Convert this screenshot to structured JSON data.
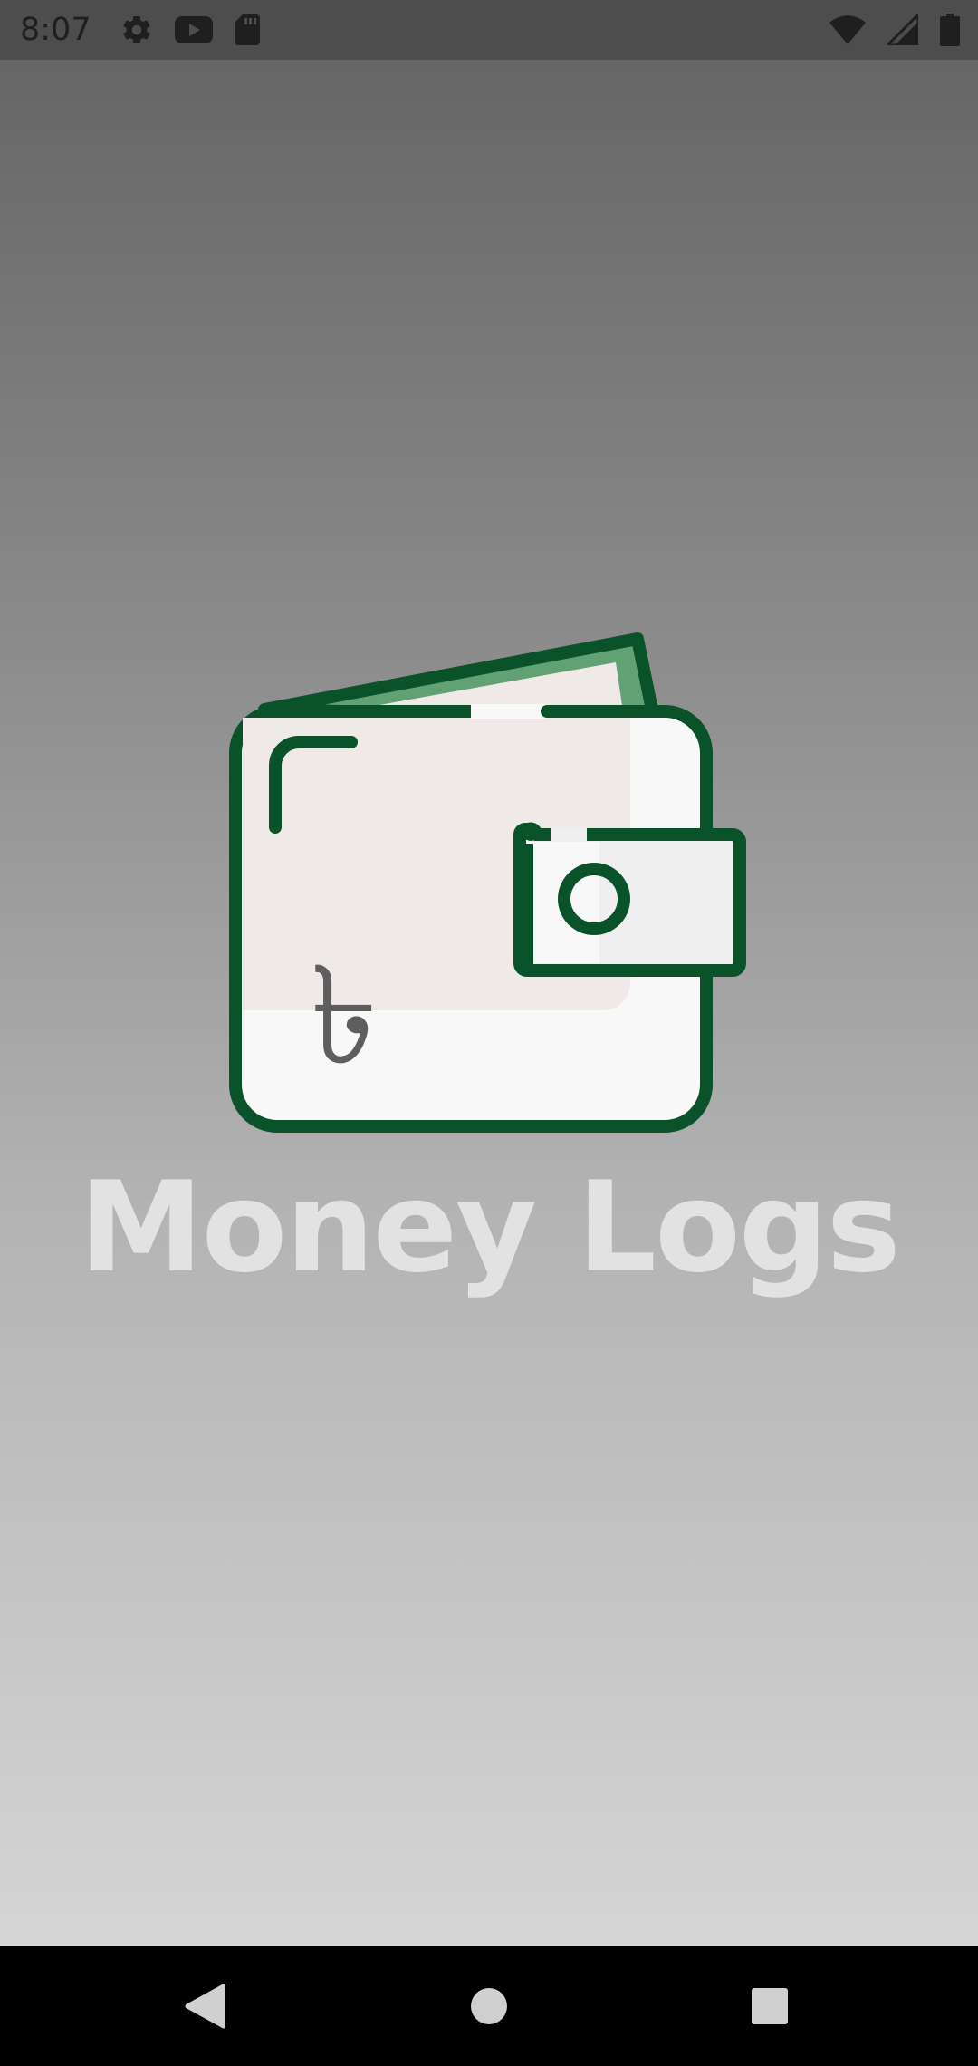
{
  "status_bar": {
    "time": "8:07",
    "left_icons": [
      "settings-icon",
      "youtube-icon",
      "sd-card-icon"
    ],
    "right_icons": [
      "wifi-icon",
      "cellular-signal-icon",
      "battery-icon"
    ]
  },
  "splash": {
    "app_name": "Money Logs",
    "logo_icon": "wallet-taka-icon",
    "currency_symbol": "৳"
  },
  "nav_bar": {
    "buttons": [
      "back-icon",
      "home-icon",
      "recents-icon"
    ]
  },
  "colors": {
    "wallet_outline": "#0a5229",
    "wallet_fill": "#f8f8f8",
    "wallet_inner": "#efeae8",
    "cash": "#62a174",
    "currency_symbol": "#5e5e5e",
    "app_name": "#e2e2e2",
    "status_bar_bg": "#4d4d4d",
    "nav_bar_bg": "#000000"
  }
}
